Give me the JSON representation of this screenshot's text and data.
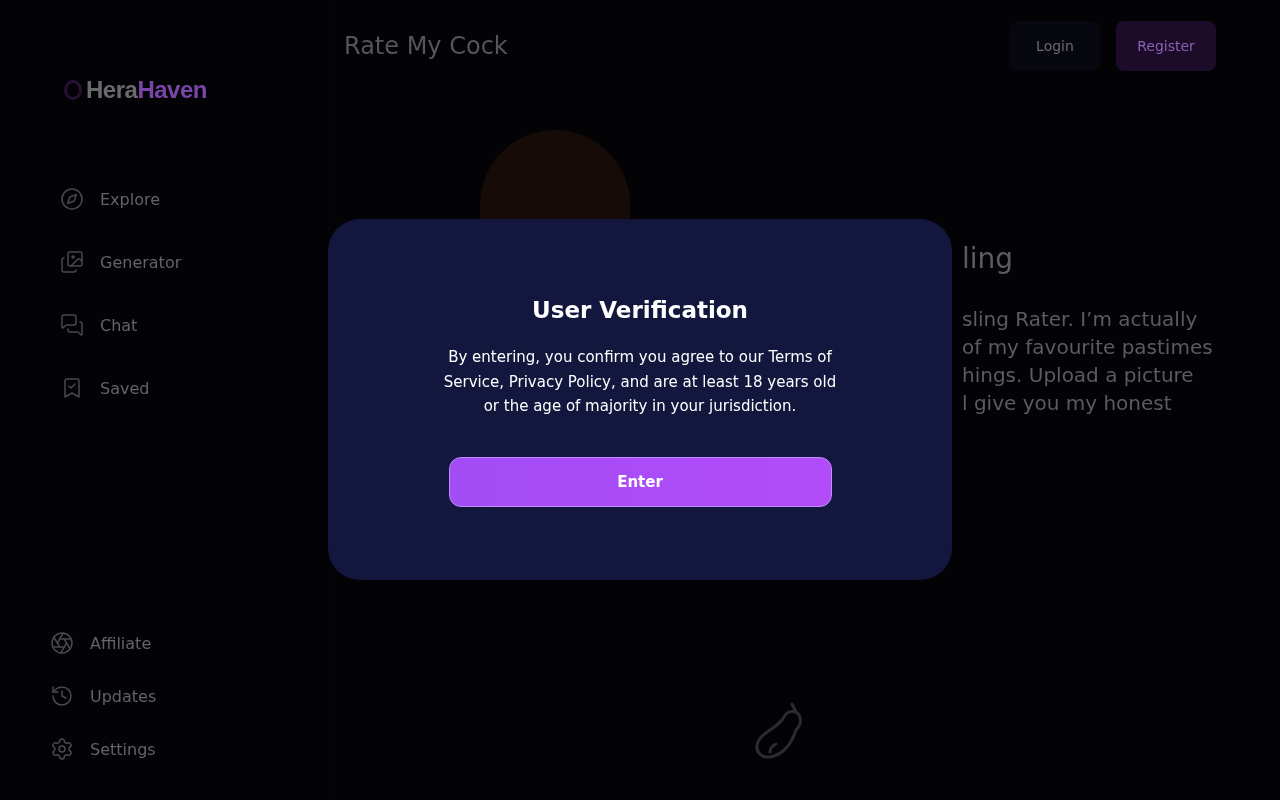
{
  "sidebar": {
    "logo": {
      "part_1": "Hera",
      "part_2": "Haven"
    },
    "nav_items": [
      {
        "label": "Explore",
        "kind": "explore"
      },
      {
        "label": "Generator",
        "kind": "generator"
      },
      {
        "label": "Chat",
        "kind": "chat"
      },
      {
        "label": "Saved",
        "kind": "saved"
      }
    ],
    "footer_items": [
      {
        "label": "Affiliate",
        "kind": "affiliate"
      },
      {
        "label": "Updates",
        "kind": "updates"
      },
      {
        "label": "Settings",
        "kind": "settings"
      }
    ]
  },
  "header": {
    "title": "Rate My Cock",
    "buttons": [
      {
        "label": "Login",
        "kind": "secondary"
      },
      {
        "label": "Register",
        "kind": "primary"
      }
    ]
  },
  "profile": {
    "name": "ling",
    "bio_lines": [
      "sling Rater. I’m actually",
      "of my favourite pastimes",
      "hings. Upload a picture",
      "l give you my honest"
    ]
  },
  "modal": {
    "title": "User Verification",
    "body": "By entering, you confirm you agree to our Terms of Service, Privacy Policy, and are at least 18 years old or the age of majority in your jurisdiction.",
    "button": "Enter"
  }
}
